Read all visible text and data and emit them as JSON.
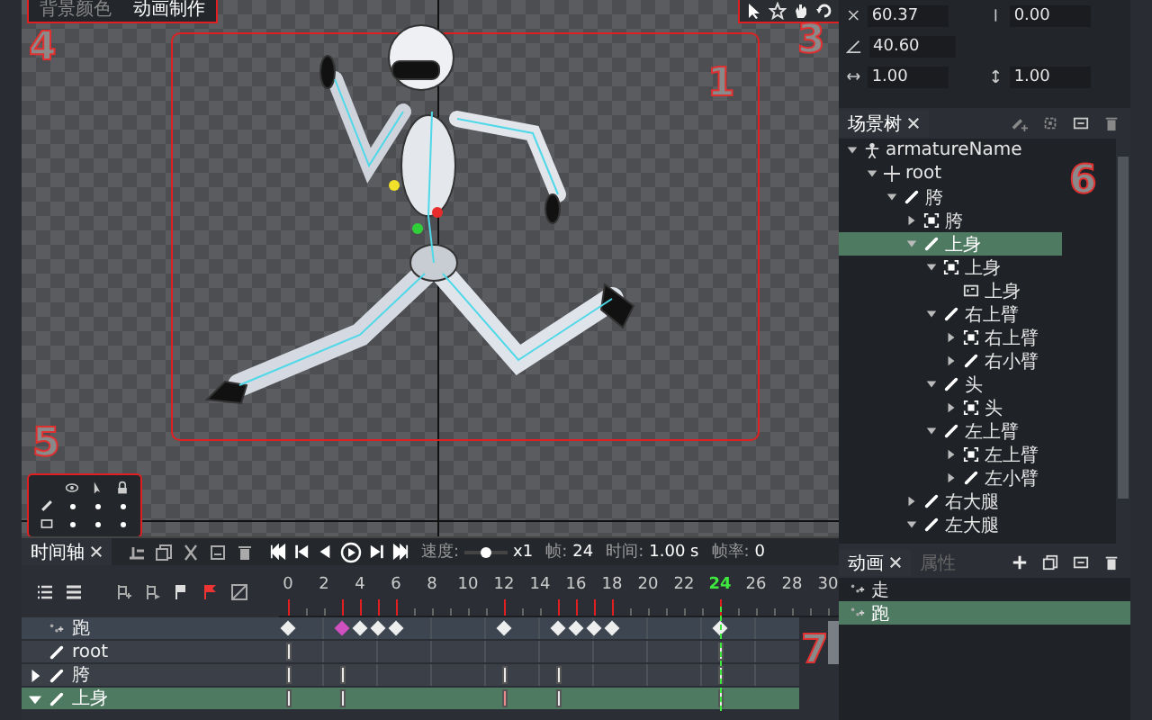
{
  "canvas": {
    "marker": "1",
    "toolbar": [
      {
        "label": "背景颜色",
        "selected": false
      },
      {
        "label": "动画制作",
        "selected": true
      }
    ],
    "toolbar_marker": "4",
    "tools_marker": "3",
    "layers": {
      "marker": "5",
      "rows": [
        {
          "kind": "bone",
          "visible": true,
          "selectable": true,
          "locked": true
        },
        {
          "kind": "image",
          "visible": true,
          "selectable": true,
          "locked": true
        }
      ]
    }
  },
  "properties": {
    "rows": [
      {
        "kind": "position",
        "a": "60.37",
        "b": "0.00"
      },
      {
        "kind": "rotation",
        "a": "40.60"
      },
      {
        "kind": "scale",
        "a": "1.00",
        "b": "1.00"
      }
    ]
  },
  "scene_tree": {
    "tab": "场景树",
    "marker": "6",
    "nodes": [
      {
        "label": "armatureName",
        "kind": "armature",
        "expanded": true,
        "selected": false,
        "children": [
          {
            "label": "root",
            "kind": "root",
            "expanded": true,
            "selected": false,
            "children": [
              {
                "label": "胯",
                "kind": "bone",
                "expanded": true,
                "selected": false,
                "children": [
                  {
                    "label": "胯",
                    "kind": "display",
                    "expanded": false,
                    "selected": false
                  },
                  {
                    "label": "上身",
                    "kind": "bone",
                    "expanded": true,
                    "selected": true,
                    "children": [
                      {
                        "label": "上身",
                        "kind": "display",
                        "expanded": true,
                        "selected": false,
                        "children": [
                          {
                            "label": "上身",
                            "kind": "image",
                            "selected": false
                          }
                        ]
                      },
                      {
                        "label": "右上臂",
                        "kind": "bone",
                        "expanded": true,
                        "selected": false,
                        "children": [
                          {
                            "label": "右上臂",
                            "kind": "display",
                            "expanded": false,
                            "selected": false
                          },
                          {
                            "label": "右小臂",
                            "kind": "bone",
                            "expanded": false,
                            "selected": false
                          }
                        ]
                      },
                      {
                        "label": "头",
                        "kind": "bone",
                        "expanded": true,
                        "selected": false,
                        "children": [
                          {
                            "label": "头",
                            "kind": "display",
                            "expanded": false,
                            "selected": false
                          }
                        ]
                      },
                      {
                        "label": "左上臂",
                        "kind": "bone",
                        "expanded": true,
                        "selected": false,
                        "children": [
                          {
                            "label": "左上臂",
                            "kind": "display",
                            "expanded": false,
                            "selected": false
                          },
                          {
                            "label": "左小臂",
                            "kind": "bone",
                            "expanded": false,
                            "selected": false
                          }
                        ]
                      }
                    ]
                  },
                  {
                    "label": "右大腿",
                    "kind": "bone",
                    "expanded": false,
                    "selected": false
                  },
                  {
                    "label": "左大腿",
                    "kind": "bone",
                    "expanded": true,
                    "selected": false
                  }
                ]
              }
            ]
          }
        ]
      }
    ]
  },
  "timeline": {
    "tab": "时间轴",
    "marker": "7",
    "speed_label": "速度:",
    "speed": {
      "level": 0.5
    },
    "speed_value": "x1",
    "frame_label": "帧:",
    "frame": "24",
    "time_label": "时间:",
    "time": "1.00 s",
    "fps_label": "帧率:",
    "fps": "0",
    "ruler": [
      {
        "label": "0",
        "selected": false
      },
      {
        "label": "2",
        "selected": false
      },
      {
        "label": "4",
        "selected": false
      },
      {
        "label": "6",
        "selected": false
      },
      {
        "label": "8",
        "selected": false
      },
      {
        "label": "10",
        "selected": false
      },
      {
        "label": "12",
        "selected": false
      },
      {
        "label": "14",
        "selected": false
      },
      {
        "label": "16",
        "selected": false
      },
      {
        "label": "18",
        "selected": false
      },
      {
        "label": "20",
        "selected": false
      },
      {
        "label": "22",
        "selected": false
      },
      {
        "label": "24",
        "selected": true
      },
      {
        "label": "26",
        "selected": false
      },
      {
        "label": "28",
        "selected": false
      },
      {
        "label": "30",
        "selected": false
      }
    ],
    "tracks": [
      {
        "name": "跑",
        "kind": "animation",
        "selected": false,
        "keys": [
          {
            "level": 0,
            "selected": false
          },
          {
            "level": 0.1,
            "selected": true
          },
          {
            "level": 0.1333,
            "selected": false
          },
          {
            "level": 0.1667,
            "selected": false
          },
          {
            "level": 0.2,
            "selected": false
          },
          {
            "level": 0.4,
            "selected": false
          },
          {
            "level": 0.5,
            "selected": false
          },
          {
            "level": 0.5333,
            "selected": false
          },
          {
            "level": 0.5667,
            "selected": false
          },
          {
            "level": 0.6,
            "selected": false
          },
          {
            "level": 0.8,
            "selected": false
          }
        ]
      },
      {
        "name": "root",
        "kind": "bone",
        "selected": false,
        "keys": [
          {
            "level": 0,
            "selected": false
          },
          {
            "level": 0.8,
            "selected": false
          }
        ]
      },
      {
        "name": "胯",
        "kind": "bone",
        "selected": false,
        "expanded": false,
        "keys": [
          {
            "level": 0,
            "selected": false
          },
          {
            "level": 0.1,
            "selected": false
          },
          {
            "level": 0.4,
            "selected": false
          },
          {
            "level": 0.5,
            "selected": false
          },
          {
            "level": 0.8,
            "selected": false
          }
        ]
      },
      {
        "name": "上身",
        "kind": "bone",
        "selected": true,
        "expanded": true,
        "keys": [
          {
            "level": 0,
            "selected": false
          },
          {
            "level": 0.1,
            "selected": false
          },
          {
            "level": 0.4,
            "selected": true
          },
          {
            "level": 0.5,
            "selected": false
          },
          {
            "level": 0.8,
            "selected": false
          }
        ]
      }
    ]
  },
  "animations": {
    "tabs": [
      {
        "label": "动画",
        "selected": true
      },
      {
        "label": "属性",
        "selected": false
      }
    ],
    "items": [
      {
        "label": "走",
        "selected": false
      },
      {
        "label": "跑",
        "selected": true
      }
    ]
  }
}
